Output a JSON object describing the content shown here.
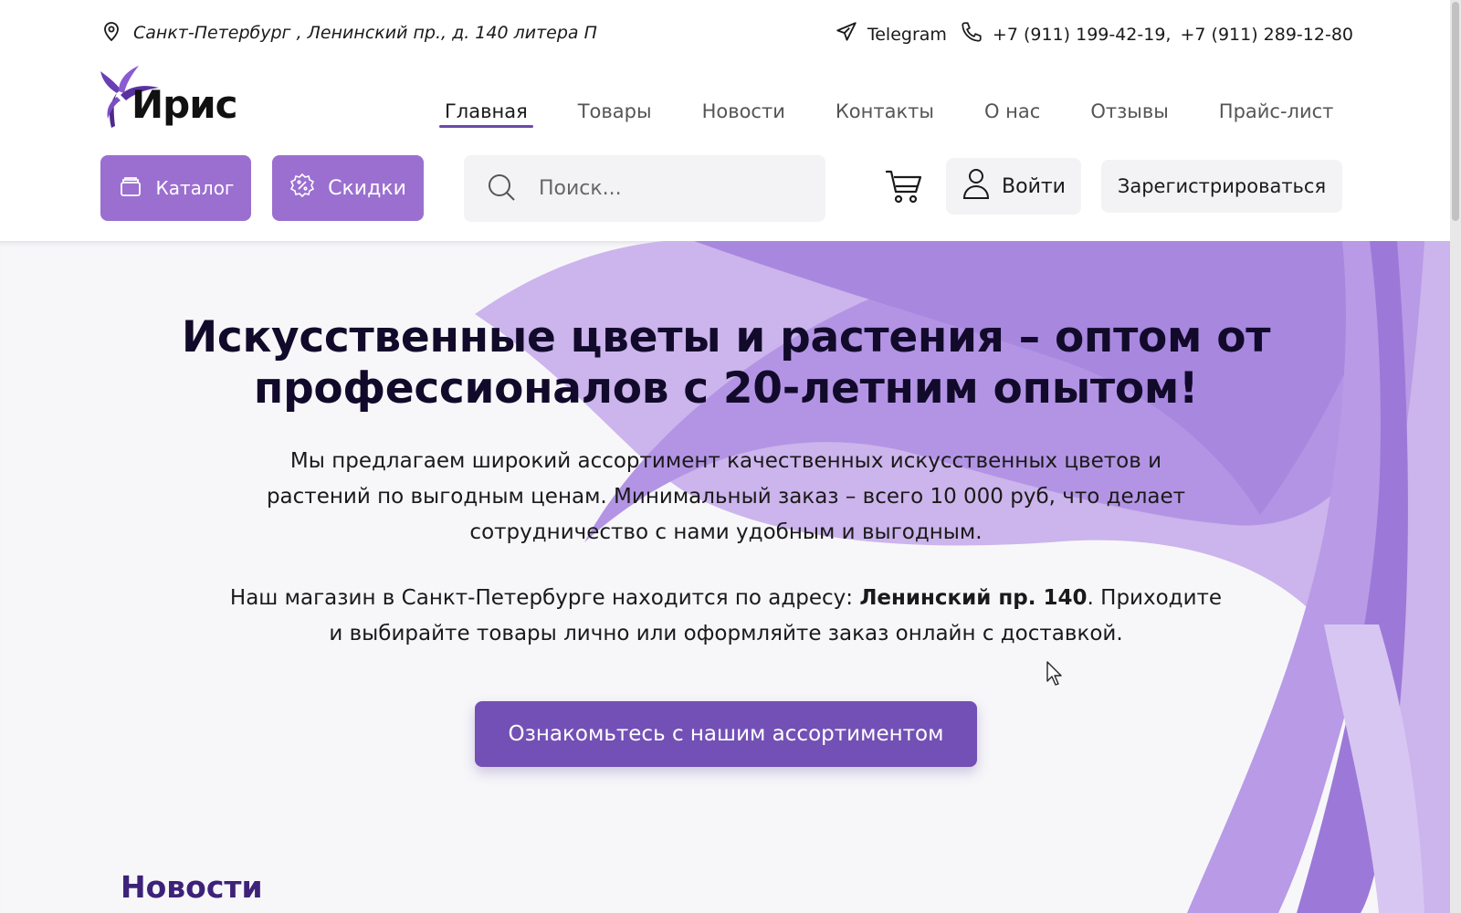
{
  "topbar": {
    "location": "Санкт-Петербург , Ленинский пр., д. 140 литера П",
    "telegram": "Telegram",
    "phone1": "+7 (911) 199-42-19,",
    "phone2": "+7 (911) 289-12-80"
  },
  "logo": {
    "text": "Ирис"
  },
  "nav": {
    "items": [
      "Главная",
      "Товары",
      "Новости",
      "Контакты",
      "О нас",
      "Отзывы",
      "Прайс-лист"
    ],
    "active": "Главная"
  },
  "toolbar": {
    "catalog_label": "Каталог",
    "sales_label": "Скидки",
    "search_placeholder": "Поиск...",
    "login_label": "Войти",
    "register_label": "Зарегистрироваться"
  },
  "hero": {
    "title": "Искусственные цветы и растения – оптом от профессионалов с 20-летним опытом!",
    "paragraph1": "Мы предлагаем широкий ассортимент качественных искусственных цветов и растений по выгодным ценам. Минимальный заказ – всего 10 000 руб, что делает сотрудничество с нами удобным и выгодным.",
    "paragraph2_before": "Наш магазин в Санкт-Петербурге находится по адресу: ",
    "paragraph2_bold": "Ленинский пр. 140",
    "paragraph2_after": ". Приходите и выбирайте товары лично или оформляйте заказ онлайн с доставкой.",
    "cta_label": "Ознакомьтесь с нашим ассортиментом"
  },
  "news": {
    "heading": "Новости"
  },
  "colors": {
    "accent": "#9b6fd0",
    "accent_dark": "#7350b5",
    "heading_dark": "#120a2a",
    "news_heading": "#3d2278"
  }
}
